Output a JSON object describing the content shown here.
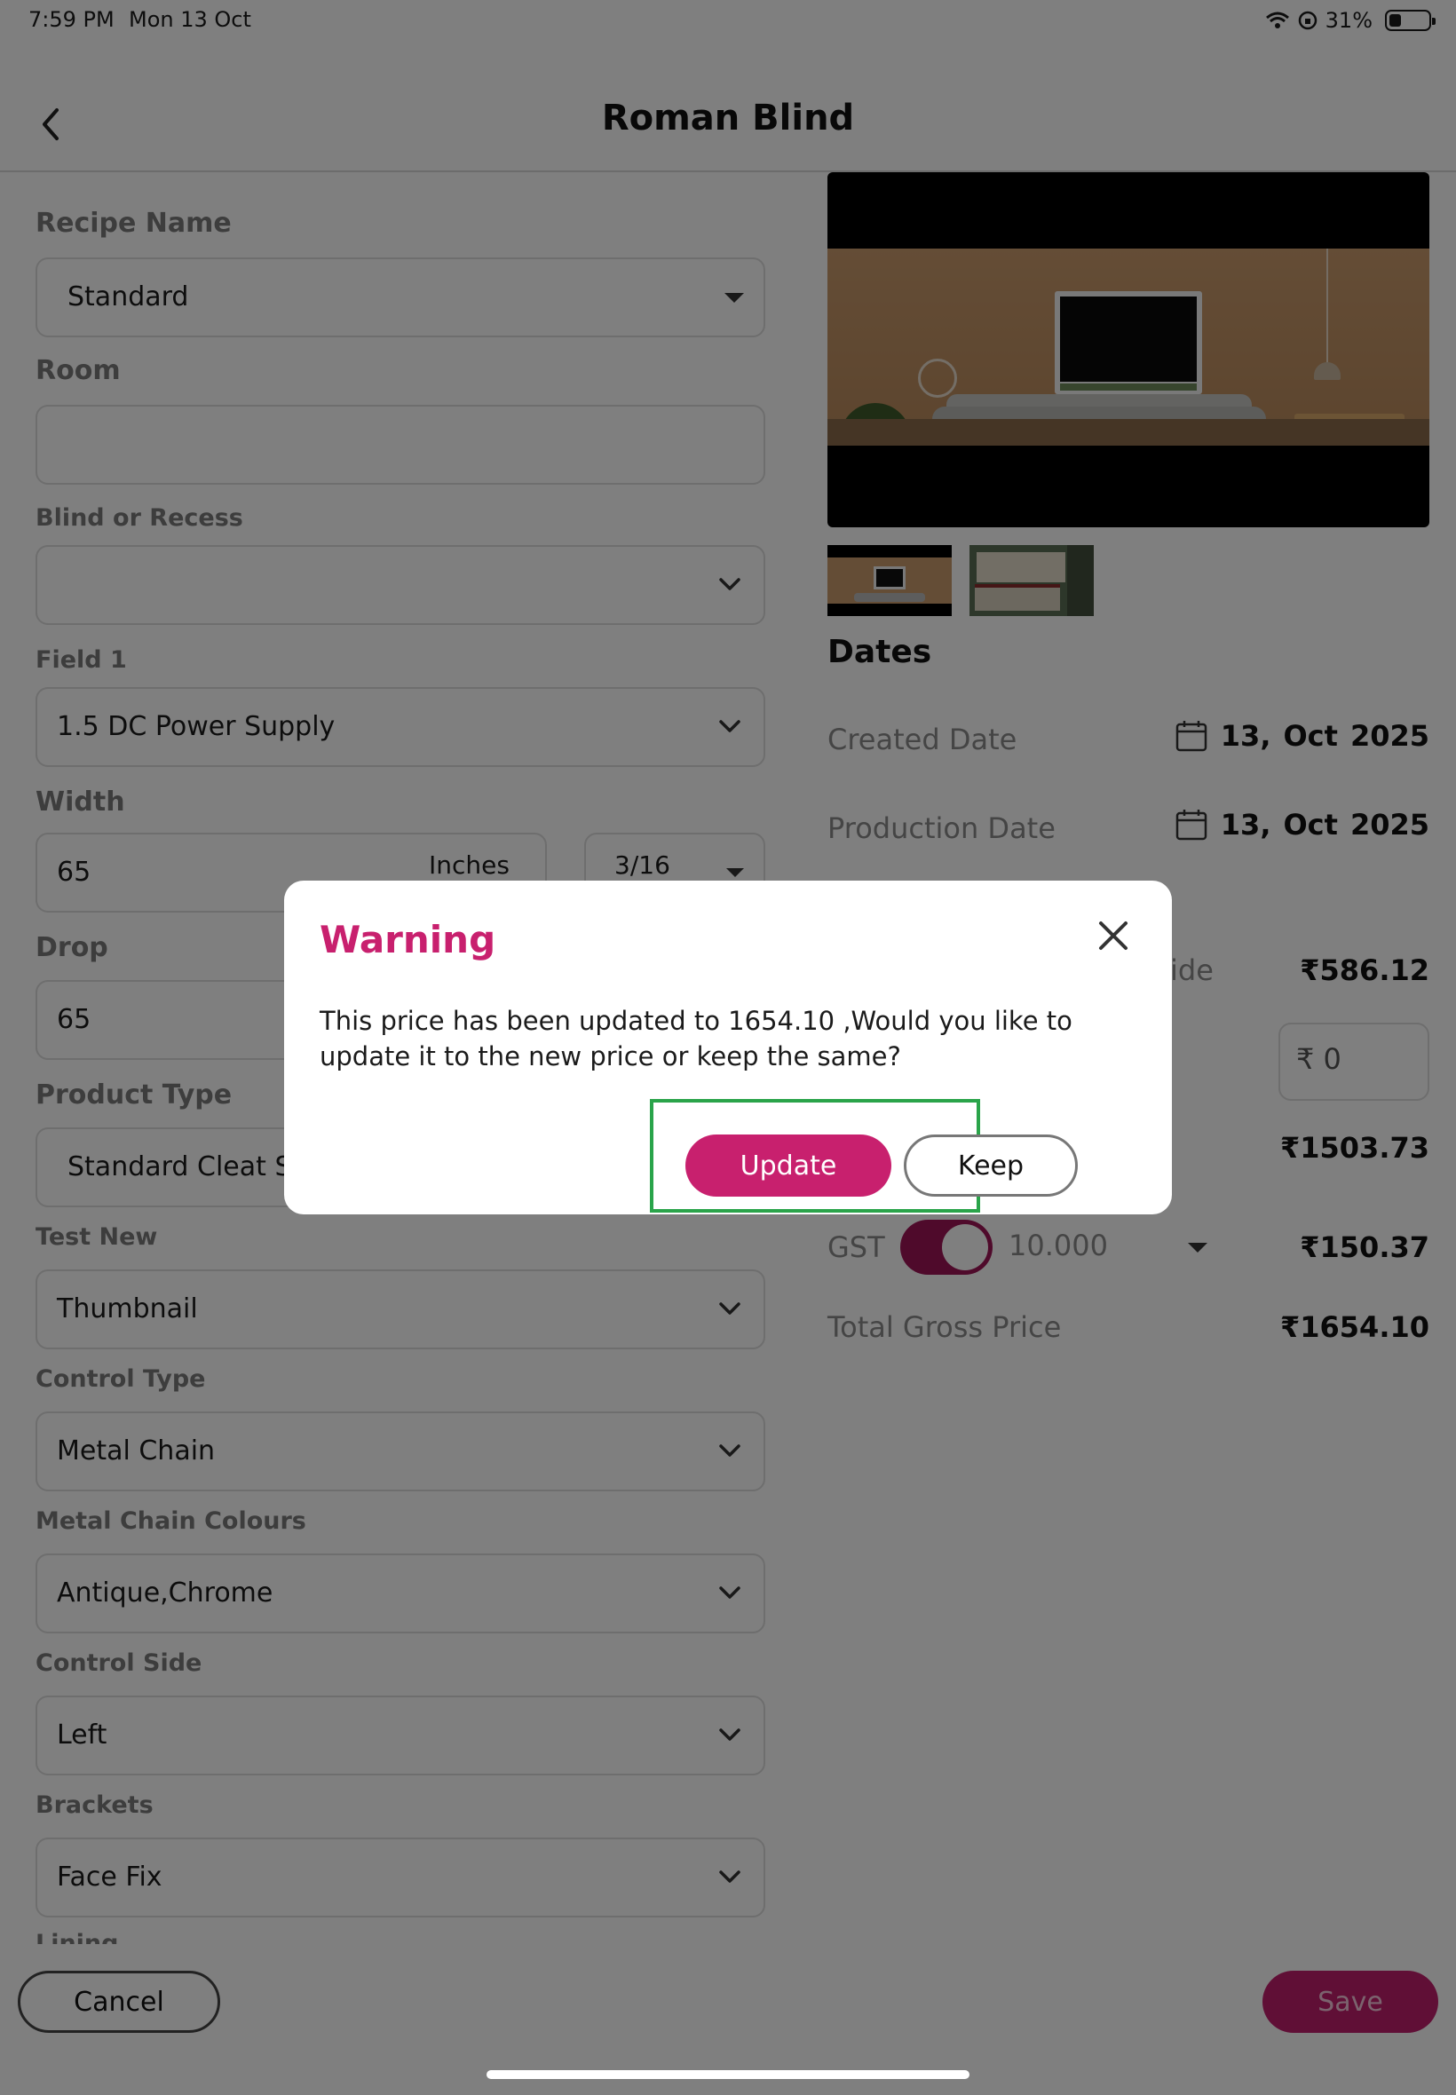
{
  "status_bar": {
    "time": "7:59 PM",
    "date": "Mon 13 Oct",
    "battery": "31%",
    "battery_level": 0.31
  },
  "header": {
    "title": "Roman Blind",
    "back_icon": "chevron-left-icon"
  },
  "form": {
    "recipe_name": {
      "label": "Recipe Name",
      "value": "Standard"
    },
    "room": {
      "label": "Room",
      "value": ""
    },
    "blind_or_recess": {
      "label": "Blind or Recess",
      "value": ""
    },
    "field1": {
      "label": "Field 1",
      "value": "1.5 DC Power Supply"
    },
    "width": {
      "label": "Width",
      "value": "65",
      "unit": "Inches",
      "fraction": "3/16"
    },
    "drop": {
      "label": "Drop",
      "value": "65"
    },
    "product_type": {
      "label": "Product Type",
      "value": "Standard Cleat Sy"
    },
    "test_new": {
      "label": "Test New",
      "value": "Thumbnail"
    },
    "control_type": {
      "label": "Control Type",
      "value": "Metal Chain"
    },
    "metal_chain_colours": {
      "label": "Metal Chain Colours",
      "value": "Antique,Chrome"
    },
    "control_side": {
      "label": "Control Side",
      "value": "Left"
    },
    "brackets": {
      "label": "Brackets",
      "value": "Face Fix"
    },
    "lining": {
      "label": "Lining"
    }
  },
  "right": {
    "dates_title": "Dates",
    "created": {
      "label": "Created Date",
      "day": "13,",
      "month": "Oct",
      "year": "2025"
    },
    "production": {
      "label": "Production Date",
      "day": "13,",
      "month": "Oct",
      "year": "2025"
    },
    "override": {
      "label_tail": "ide",
      "value": "₹586.12"
    },
    "override_input": {
      "currency": "₹",
      "value": "0"
    },
    "net_value": "₹1503.73",
    "gst": {
      "label": "GST",
      "rate": "10.000",
      "value": "₹150.37",
      "enabled": true
    },
    "total": {
      "label": "Total Gross Price",
      "value": "₹1654.10"
    }
  },
  "footer": {
    "cancel": "Cancel",
    "save": "Save"
  },
  "dialog": {
    "title": "Warning",
    "message": "This price has been updated to 1654.10 ,Would you like to update it to the new price or keep the same?",
    "update": "Update",
    "keep": "Keep"
  },
  "colors": {
    "accent": "#c8206e",
    "highlight": "#2aa44a",
    "toggle": "#9e1556"
  }
}
